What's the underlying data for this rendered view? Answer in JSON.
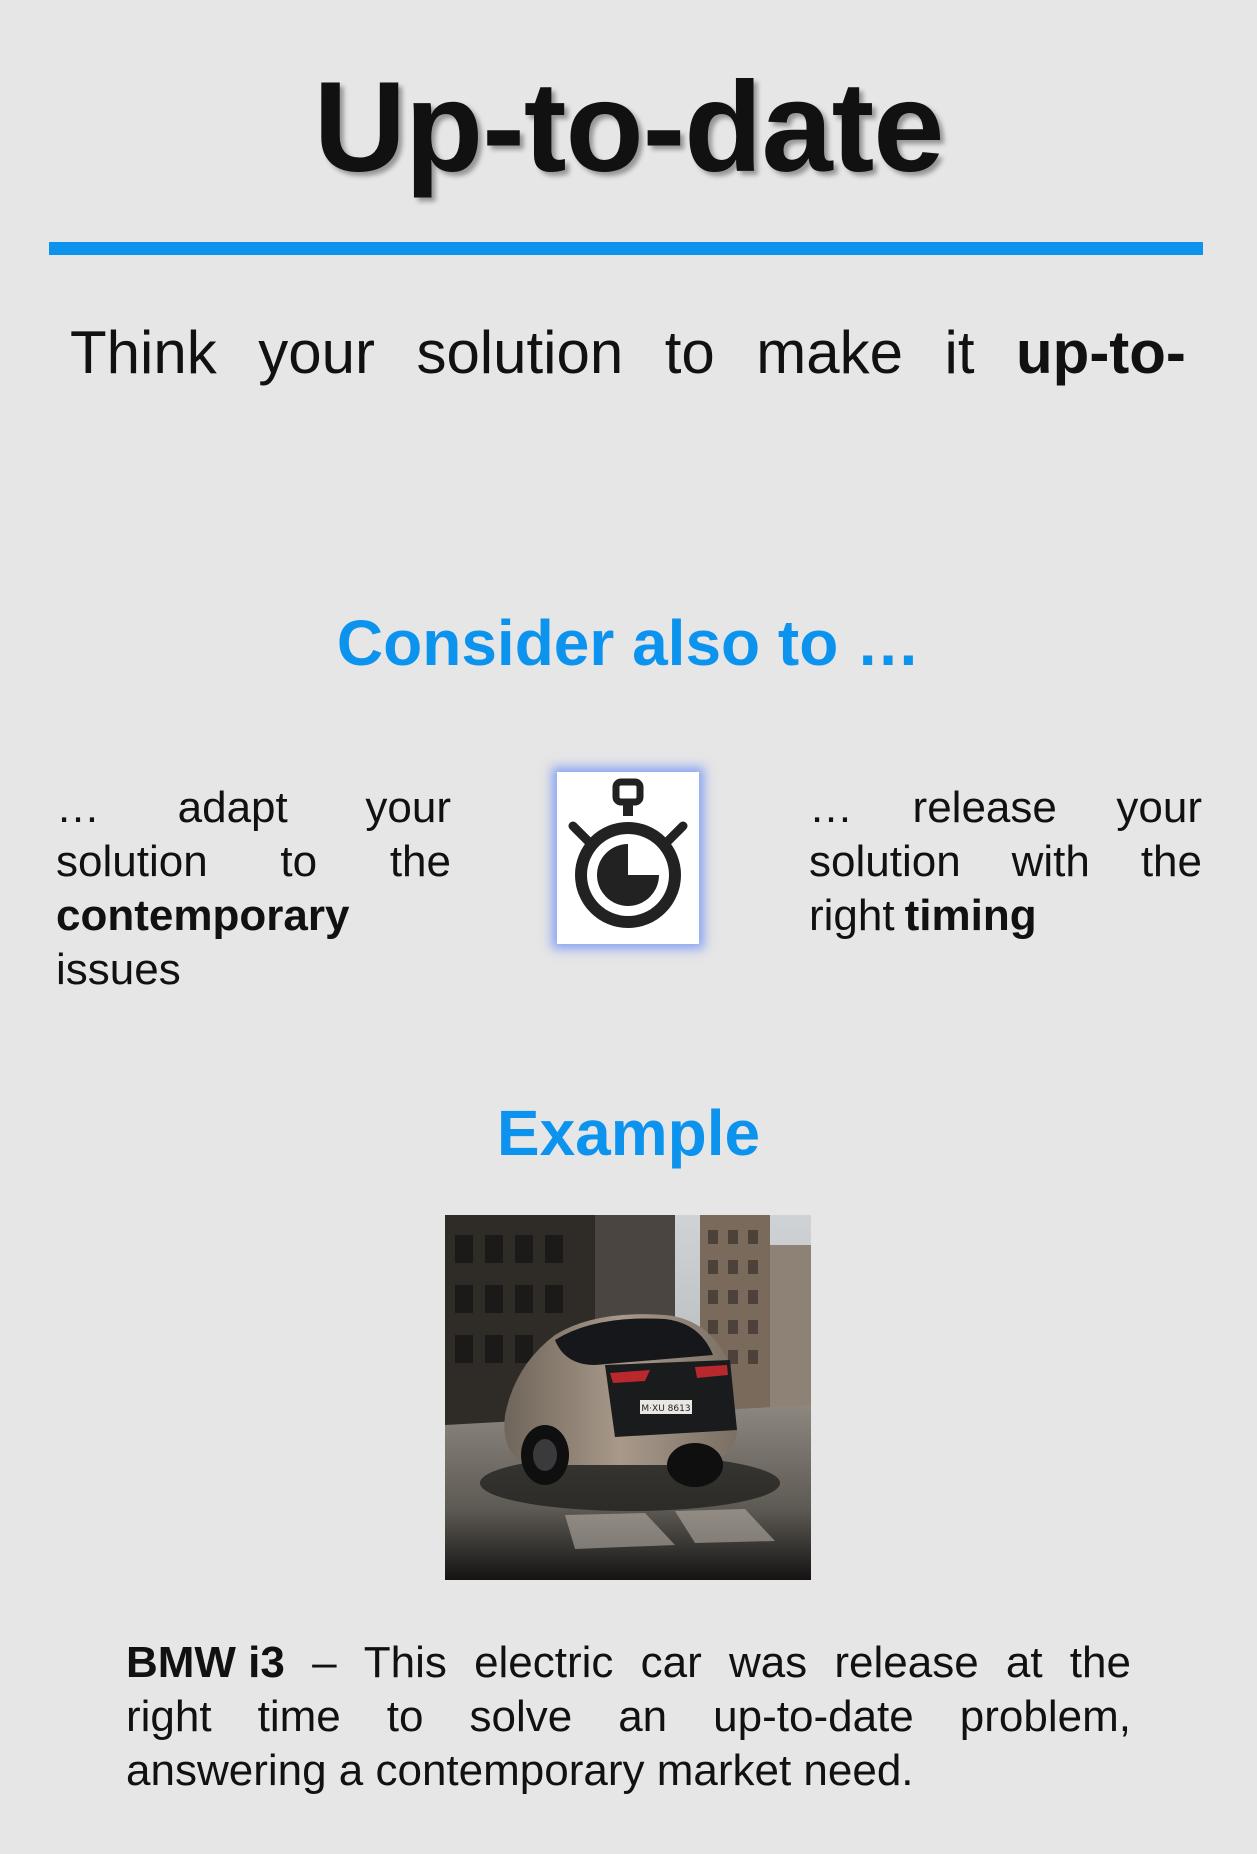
{
  "title": "Up-to-date",
  "intro": {
    "words": [
      "Think",
      "your",
      "solution",
      "to",
      "make",
      "it"
    ],
    "bold": "up-to-"
  },
  "consider": {
    "heading": "Consider also to …",
    "left": {
      "line1": [
        "…",
        "adapt",
        "your"
      ],
      "line2": [
        "solution",
        "to",
        "the"
      ],
      "bold": "contemporary",
      "line4": "issues"
    },
    "right": {
      "line1": [
        "…",
        "release",
        "your"
      ],
      "line2": [
        "solution",
        "with",
        "the"
      ],
      "line3_prefix": "right",
      "bold": "timing"
    },
    "icon": "stopwatch-icon"
  },
  "example": {
    "heading": "Example",
    "image": "bmw-i3-photo",
    "plate": "M·XU 8613",
    "caption": {
      "bold": "BMW i3",
      "line1": [
        "–",
        "This",
        "electric",
        "car",
        "was",
        "release",
        "at",
        "the"
      ],
      "line2": [
        "right",
        "time",
        "to",
        "solve",
        "an",
        "up-to-date",
        "problem,"
      ],
      "line3": "answering a contemporary market need."
    }
  },
  "colors": {
    "accent": "#0c93ee",
    "background": "#e6e6e6",
    "text": "#111111"
  }
}
